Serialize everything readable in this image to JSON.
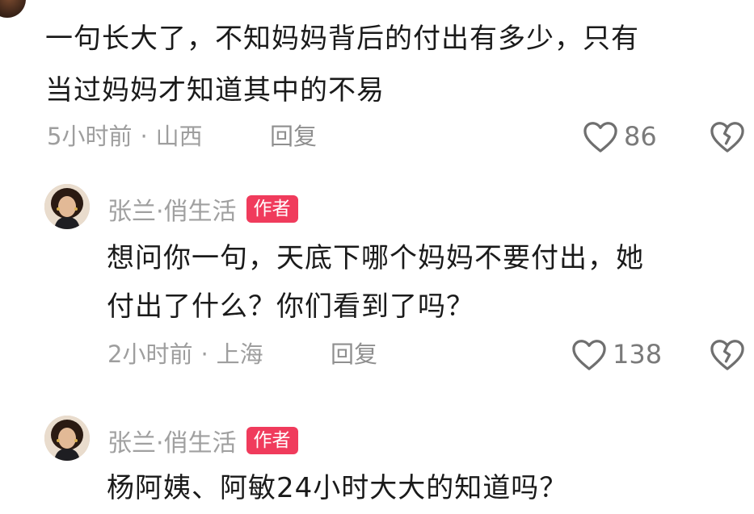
{
  "comments": [
    {
      "text_lines": [
        "一句长大了，不知妈妈背后的付出有多少，只有",
        "当过妈妈才知道其中的不易"
      ],
      "time": "5小时前",
      "separator": "·",
      "location": "山西",
      "reply_label": "回复",
      "like_count": "86"
    },
    {
      "author": "张兰·俏生活",
      "badge": "作者",
      "text_lines": [
        "想问你一句，天底下哪个妈妈不要付出，她",
        "付出了什么？你们看到了吗？"
      ],
      "time": "2小时前",
      "separator": "·",
      "location": "上海",
      "reply_label": "回复",
      "like_count": "138"
    },
    {
      "author": "张兰·俏生活",
      "badge": "作者",
      "text_lines": [
        "杨阿姨、阿敏24小时大大的知道吗？"
      ]
    }
  ],
  "icons": {
    "like": "heart-outline-icon",
    "dislike": "broken-heart-icon"
  },
  "colors": {
    "badge_bg": "#f03b5c",
    "meta_text": "#9e9e9e",
    "body_text": "#1a1a1a"
  }
}
